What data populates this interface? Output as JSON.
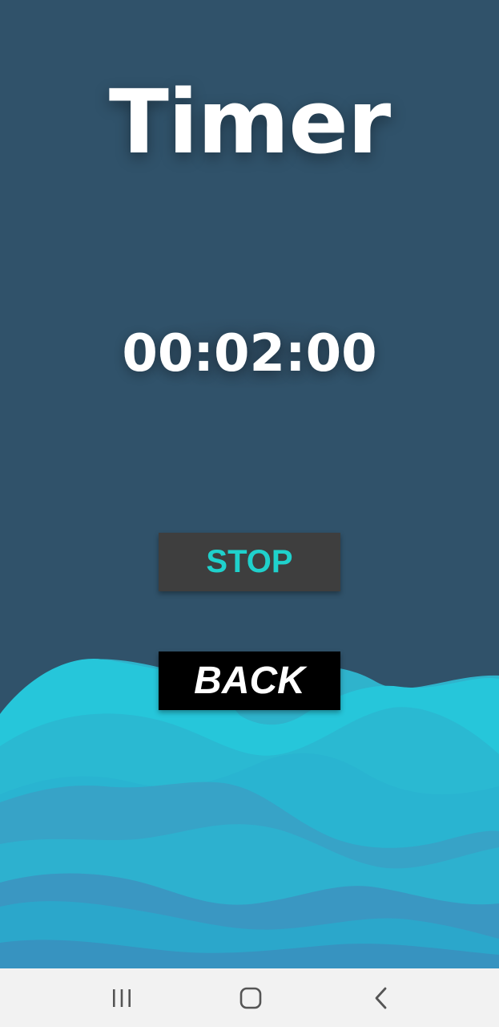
{
  "app": {
    "title": "Timer",
    "time_display": "00:02:00"
  },
  "buttons": {
    "stop_label": "STOP",
    "back_label": "BACK"
  },
  "nav_bar": {
    "items": [
      {
        "name": "recents",
        "icon": "recents-icon"
      },
      {
        "name": "home",
        "icon": "home-icon"
      },
      {
        "name": "back",
        "icon": "back-chevron-icon"
      }
    ]
  },
  "colors": {
    "background": "#30526a",
    "stop_button_bg": "#3e3e3e",
    "stop_button_text": "#1fd1cc",
    "back_button_bg": "#000000",
    "back_button_text": "#ffffff",
    "wave_light": "#26c6da",
    "nav_bar_bg": "#f2f2f2"
  }
}
